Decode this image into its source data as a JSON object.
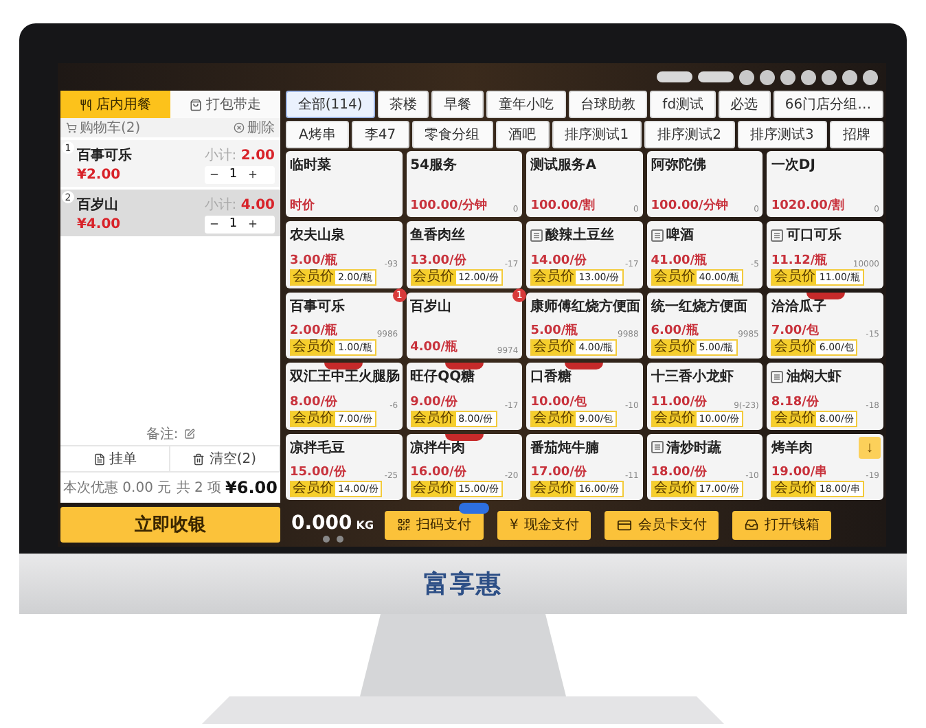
{
  "order_tabs": [
    {
      "label": "店内用餐",
      "kind": "dine",
      "selected": true
    },
    {
      "label": "打包带走",
      "kind": "takeaway",
      "selected": false
    }
  ],
  "cart": {
    "title": "购物车(2)",
    "delete_label": "删除",
    "items": [
      {
        "index": "1",
        "name": "百事可乐",
        "subtotal_label": "小计:",
        "subtotal": "2.00",
        "price": "¥2.00",
        "qty": "1",
        "selected": false
      },
      {
        "index": "2",
        "name": "百岁山",
        "subtotal_label": "小计:",
        "subtotal": "4.00",
        "price": "¥4.00",
        "qty": "1",
        "selected": true
      }
    ],
    "remark_label": "备注:",
    "actions": [
      {
        "label": "挂单",
        "kind": "hold"
      },
      {
        "label": "清空(2)",
        "kind": "clear"
      }
    ],
    "discount": "本次优惠 0.00 元",
    "count": "共 2 项",
    "total": "¥6.00"
  },
  "categories": [
    [
      {
        "label": "全部(114)",
        "selected": true
      },
      {
        "label": "茶楼",
        "selected": false
      },
      {
        "label": "早餐",
        "selected": false
      },
      {
        "label": "童年小吃",
        "selected": false
      },
      {
        "label": "台球助教",
        "selected": false
      },
      {
        "label": "fd测试",
        "selected": false
      },
      {
        "label": "必选",
        "selected": false
      },
      {
        "label": "66门店分组…",
        "selected": false
      }
    ],
    [
      {
        "label": "A烤串",
        "selected": false
      },
      {
        "label": "李47",
        "selected": false
      },
      {
        "label": "零食分组",
        "selected": false
      },
      {
        "label": "酒吧",
        "selected": false
      },
      {
        "label": "排序测试1",
        "selected": false
      },
      {
        "label": "排序测试2",
        "selected": false
      },
      {
        "label": "排序测试3",
        "selected": false
      },
      {
        "label": "招牌",
        "selected": false
      }
    ]
  ],
  "products": [
    {
      "name": "临时菜",
      "has_icon": false,
      "ribbon": false,
      "price": "时价"
    },
    {
      "name": "54服务",
      "has_icon": false,
      "ribbon": false,
      "price": "100.00/分钟",
      "stock": "0"
    },
    {
      "name": "测试服务A",
      "has_icon": false,
      "ribbon": false,
      "price": "100.00/割",
      "stock": "0"
    },
    {
      "name": "阿弥陀佛",
      "has_icon": false,
      "ribbon": false,
      "price": "100.00/分钟",
      "stock": "0"
    },
    {
      "name": "一次DJ",
      "has_icon": false,
      "ribbon": false,
      "price": "1020.00/割",
      "stock": "0"
    },
    {
      "name": "农夫山泉",
      "has_icon": false,
      "ribbon": false,
      "price": "3.00/瓶",
      "stock": "-93",
      "member": {
        "label": "会员价",
        "price": "2.00/瓶"
      }
    },
    {
      "name": "鱼香肉丝",
      "has_icon": false,
      "ribbon": false,
      "price": "13.00/份",
      "stock": "-17",
      "member": {
        "label": "会员价",
        "price": "12.00/份"
      }
    },
    {
      "name": "酸辣土豆丝",
      "has_icon": true,
      "ribbon": false,
      "price": "14.00/份",
      "stock": "-17",
      "member": {
        "label": "会员价",
        "price": "13.00/份"
      }
    },
    {
      "name": "啤酒",
      "has_icon": true,
      "ribbon": false,
      "price": "41.00/瓶",
      "stock": "-5",
      "member": {
        "label": "会员价",
        "price": "40.00/瓶"
      }
    },
    {
      "name": "可口可乐",
      "has_icon": true,
      "ribbon": false,
      "price": "11.12/瓶",
      "stock": "10000",
      "member": {
        "label": "会员价",
        "price": "11.00/瓶"
      }
    },
    {
      "name": "百事可乐",
      "has_icon": false,
      "ribbon": false,
      "price": "2.00/瓶",
      "stock": "9986",
      "badge": "1",
      "member": {
        "label": "会员价",
        "price": "1.00/瓶"
      }
    },
    {
      "name": "百岁山",
      "has_icon": false,
      "ribbon": false,
      "price": "4.00/瓶",
      "stock": "9974",
      "badge": "1"
    },
    {
      "name": "康师傅红烧方便面",
      "has_icon": false,
      "ribbon": false,
      "price": "5.00/瓶",
      "stock": "9988",
      "member": {
        "label": "会员价",
        "price": "4.00/瓶"
      }
    },
    {
      "name": "统一红烧方便面",
      "has_icon": false,
      "ribbon": false,
      "price": "6.00/瓶",
      "stock": "9985",
      "member": {
        "label": "会员价",
        "price": "5.00/瓶"
      }
    },
    {
      "name": "洽洽瓜子",
      "has_icon": false,
      "ribbon": true,
      "price": "7.00/包",
      "stock": "-15",
      "member": {
        "label": "会员价",
        "price": "6.00/包"
      }
    },
    {
      "name": "双汇王中王火腿肠",
      "has_icon": false,
      "ribbon": true,
      "price": "8.00/份",
      "stock": "-6",
      "member": {
        "label": "会员价",
        "price": "7.00/份"
      }
    },
    {
      "name": "旺仔QQ糖",
      "has_icon": false,
      "ribbon": true,
      "price": "9.00/份",
      "stock": "-17",
      "member": {
        "label": "会员价",
        "price": "8.00/份"
      }
    },
    {
      "name": "口香糖",
      "has_icon": false,
      "ribbon": true,
      "price": "10.00/包",
      "stock": "-10",
      "member": {
        "label": "会员价",
        "price": "9.00/包"
      }
    },
    {
      "name": "十三香小龙虾",
      "has_icon": false,
      "ribbon": false,
      "price": "11.00/份",
      "stock": "9(-23)",
      "member": {
        "label": "会员价",
        "price": "10.00/份"
      }
    },
    {
      "name": "油焖大虾",
      "has_icon": true,
      "ribbon": false,
      "price": "8.18/份",
      "stock": "-18",
      "member": {
        "label": "会员价",
        "price": "8.00/份"
      }
    },
    {
      "name": "凉拌毛豆",
      "has_icon": false,
      "ribbon": false,
      "price": "15.00/份",
      "stock": "-25",
      "member": {
        "label": "会员价",
        "price": "14.00/份"
      }
    },
    {
      "name": "凉拌牛肉",
      "has_icon": false,
      "ribbon": true,
      "price": "16.00/份",
      "stock": "-20",
      "member": {
        "label": "会员价",
        "price": "15.00/份"
      }
    },
    {
      "name": "番茄炖牛腩",
      "has_icon": false,
      "ribbon": false,
      "price": "17.00/份",
      "stock": "-11",
      "member": {
        "label": "会员价",
        "price": "16.00/份"
      }
    },
    {
      "name": "清炒时蔬",
      "has_icon": true,
      "ribbon": false,
      "price": "18.00/份",
      "stock": "-10",
      "member": {
        "label": "会员价",
        "price": "17.00/份"
      }
    },
    {
      "name": "烤羊肉",
      "has_icon": false,
      "ribbon": false,
      "price": "19.00/串",
      "stock": "-19",
      "member": {
        "label": "会员价",
        "price": "18.00/串"
      }
    }
  ],
  "scroll_button": {
    "label": "↓"
  },
  "checkout": {
    "label": "立即收银"
  },
  "scale": {
    "weight": "0.000",
    "unit": "KG"
  },
  "payments": [
    {
      "label": "扫码支付",
      "kind": "qr",
      "flag": true
    },
    {
      "label": "现金支付",
      "kind": "cash",
      "icon_text": "¥",
      "flag": false
    },
    {
      "label": "会员卡支付",
      "kind": "card",
      "flag": false
    },
    {
      "label": "打开钱箱",
      "kind": "drawer",
      "flag": false
    }
  ],
  "brand": {
    "logo": "富享惠"
  }
}
